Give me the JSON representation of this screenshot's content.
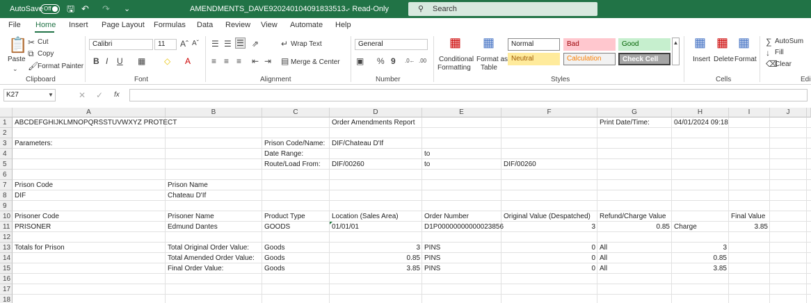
{
  "titlebar": {
    "autosave": "AutoSave",
    "autosave_state": "Off",
    "title": "AMENDMENTS_DAVE920240104091833513  -  Read-Only",
    "search_placeholder": "Search"
  },
  "tabs": [
    "File",
    "Home",
    "Insert",
    "Page Layout",
    "Formulas",
    "Data",
    "Review",
    "View",
    "Automate",
    "Help"
  ],
  "ribbon": {
    "clipboard": {
      "paste": "Paste",
      "cut": "Cut",
      "copy": "Copy",
      "format_painter": "Format Painter",
      "label": "Clipboard"
    },
    "font": {
      "name": "Calibri",
      "size": "11",
      "label": "Font"
    },
    "alignment": {
      "wrap": "Wrap Text",
      "merge": "Merge & Center",
      "label": "Alignment"
    },
    "number": {
      "format": "General",
      "label": "Number"
    },
    "styles": {
      "conditional": "Conditional",
      "conditional2": "Formatting",
      "format_as": "Format as",
      "format_as2": "Table",
      "normal": "Normal",
      "bad": "Bad",
      "good": "Good",
      "neutral": "Neutral",
      "calculation": "Calculation",
      "check_cell": "Check Cell",
      "label": "Styles"
    },
    "cells": {
      "insert": "Insert",
      "delete": "Delete",
      "format": "Format",
      "label": "Cells"
    },
    "editing": {
      "autosum": "AutoSum",
      "fill": "Fill",
      "clear": "Clear",
      "label": "Edi"
    }
  },
  "formula_bar": {
    "name_box": "K27",
    "fx": "fx",
    "value": ""
  },
  "columns": [
    "A",
    "B",
    "C",
    "D",
    "E",
    "F",
    "G",
    "H",
    "I",
    "J"
  ],
  "rows": [
    "1",
    "2",
    "3",
    "4",
    "5",
    "6",
    "7",
    "8",
    "9",
    "10",
    "11",
    "12",
    "13",
    "14",
    "15",
    "16",
    "17",
    "18"
  ],
  "cells": {
    "A1": "ABCDEFGHIJKLMNOPQRSSTUVWXYZ PROTECT",
    "D1": "Order Amendments Report",
    "G1": "Print Date/Time:",
    "H1": "04/01/2024 09:18",
    "A3": "Parameters:",
    "C3": "Prison Code/Name:",
    "D3": "DIF/Chateau D'If",
    "C4": "Date Range:",
    "E4": "to",
    "C5": "Route/Load From:",
    "D5": "DIF/00260",
    "E5": "to",
    "F5": "DIF/00260",
    "A7": "Prison Code",
    "B7": "Prison Name",
    "A8": "DIF",
    "B8": "Chateau D'If",
    "A10": "Prisoner Code",
    "B10": "Prisoner Name",
    "C10": "Product Type",
    "D10": "Location (Sales Area)",
    "E10": "Order Number",
    "F10": "Original Value (Despatched)",
    "G10": "Refund/Charge Value",
    "I10": "Final Value",
    "A11": "PRISONER",
    "B11": "Edmund Dantes",
    "C11": "GOODS",
    "D11": "01/01/01",
    "E11": "D1P00000000000023856",
    "F11": "3",
    "G11": "0.85",
    "H11": "Charge",
    "I11": "3.85",
    "A13": "Totals for Prison",
    "B13": "Total Original Order Value:",
    "C13": "Goods",
    "D13": "3",
    "E13": "PINS",
    "F13": "0",
    "G13": "All",
    "H13": "3",
    "B14": "Total Amended Order Value:",
    "C14": "Goods",
    "D14": "0.85",
    "E14": "PINS",
    "F14": "0",
    "G14": "All",
    "H14": "0.85",
    "B15": "Final Order Value:",
    "C15": "Goods",
    "D15": "3.85",
    "E15": "PINS",
    "F15": "0",
    "G15": "All",
    "H15": "3.85"
  }
}
